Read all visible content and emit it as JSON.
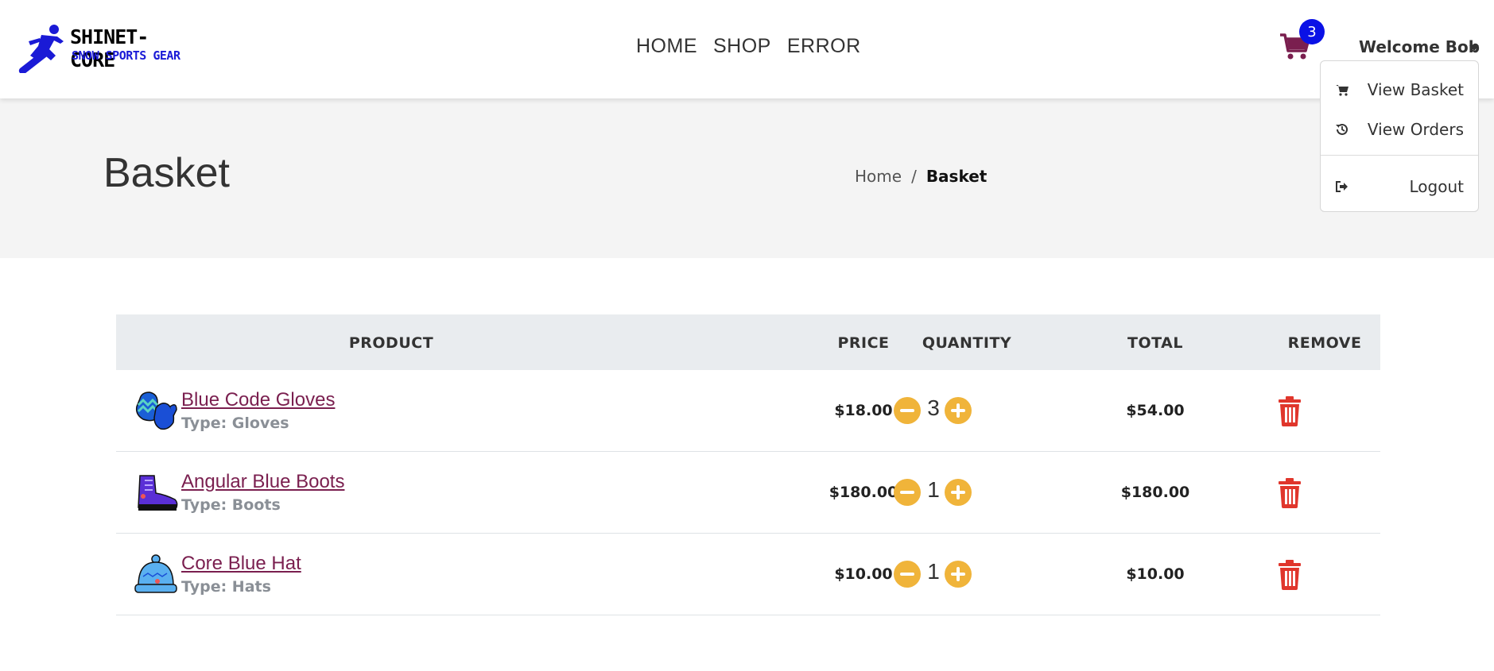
{
  "brand": {
    "line1": "SHINET-CORE",
    "line2": "SNOW SPORTS GEAR",
    "accent": "#1a1ad6"
  },
  "nav": {
    "items": [
      "HOME",
      "SHOP",
      "ERROR"
    ]
  },
  "cart": {
    "count": "3",
    "icon": "shopping-cart-icon",
    "icon_color": "#7a1f4f",
    "badge_color": "#0a11e6"
  },
  "user_menu": {
    "welcome": "Welcome Bob",
    "items": [
      {
        "label": "View Basket",
        "icon": "shopping-cart-icon"
      },
      {
        "label": "View Orders",
        "icon": "history-icon"
      },
      {
        "label": "Logout",
        "icon": "sign-out-icon"
      }
    ]
  },
  "page": {
    "title": "Basket",
    "breadcrumb": {
      "home": "Home",
      "separator": "/",
      "current": "Basket"
    }
  },
  "table": {
    "headers": {
      "product": "PRODUCT",
      "price": "PRICE",
      "quantity": "QUANTITY",
      "total": "TOTAL",
      "remove": "REMOVE"
    },
    "rows": [
      {
        "name": "Blue Code Gloves",
        "type": "Type: Gloves",
        "price": "$18.00",
        "quantity": "3",
        "total": "$54.00",
        "icon": "gloves-icon"
      },
      {
        "name": "Angular Blue Boots",
        "type": "Type: Boots",
        "price": "$180.00",
        "quantity": "1",
        "total": "$180.00",
        "icon": "boot-icon"
      },
      {
        "name": "Core Blue Hat",
        "type": "Type: Hats",
        "price": "$10.00",
        "quantity": "1",
        "total": "$10.00",
        "icon": "hat-icon"
      }
    ],
    "colors": {
      "qty_button": "#f0b43a",
      "remove_icon": "#e0362c",
      "product_link": "#7a1f4f"
    }
  }
}
